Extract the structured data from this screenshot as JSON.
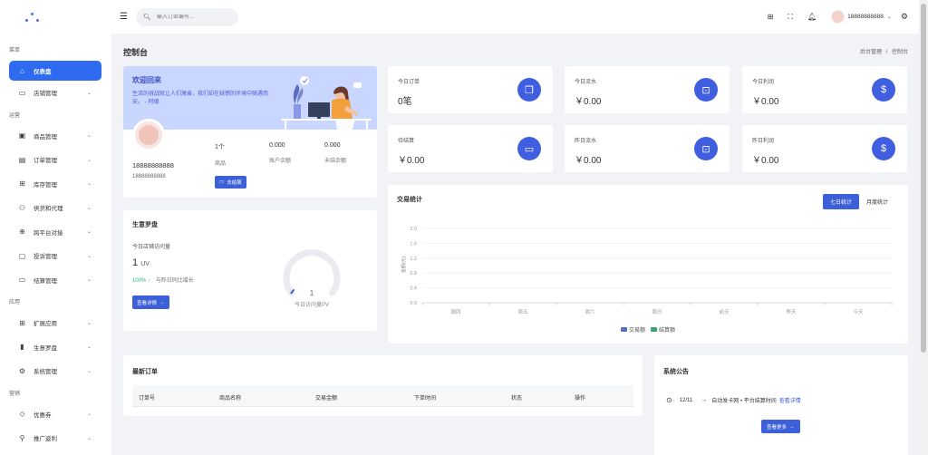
{
  "sidebar": {
    "sections": [
      {
        "label": "菜单",
        "items": [
          {
            "label": "仪表盘",
            "icon": "home-icon",
            "active": true
          },
          {
            "label": "店铺管理",
            "icon": "store-icon"
          }
        ]
      },
      {
        "label": "运营",
        "items": [
          {
            "label": "商品管理",
            "icon": "goods-icon"
          },
          {
            "label": "订单管理",
            "icon": "order-icon"
          },
          {
            "label": "库存管理",
            "icon": "inventory-icon"
          },
          {
            "label": "供货和代理",
            "icon": "supply-icon"
          },
          {
            "label": "跨平台对接",
            "icon": "globe-icon"
          },
          {
            "label": "投诉管理",
            "icon": "complaint-icon"
          },
          {
            "label": "结算管理",
            "icon": "settlement-icon"
          }
        ]
      },
      {
        "label": "应用",
        "items": [
          {
            "label": "扩展应用",
            "icon": "apps-icon"
          },
          {
            "label": "生意罗盘",
            "icon": "bar-chart-icon"
          },
          {
            "label": "系统管理",
            "icon": "gear-icon"
          }
        ]
      },
      {
        "label": "营销",
        "items": [
          {
            "label": "优惠券",
            "icon": "coupon-icon"
          },
          {
            "label": "推广返利",
            "icon": "promo-icon"
          }
        ]
      }
    ]
  },
  "topbar": {
    "search_placeholder": "输入订单编号...",
    "username": "18888888888"
  },
  "page": {
    "title": "控制台",
    "breadcrumb": [
      "后台管理",
      "/",
      "控制台"
    ]
  },
  "welcome": {
    "title": "欢迎回来",
    "subtitle": "生活的挑战就让人们激奋，我们却在缺憾的环境中随遇而安。 - 阿德",
    "phone": "18888888888",
    "account": "18888888888",
    "stats": [
      {
        "value": "1个",
        "label": "商品"
      },
      {
        "value": "0.000",
        "label": "账户余额"
      },
      {
        "value": "0.000",
        "label": "未结余额"
      }
    ],
    "settle_button": "去结算"
  },
  "stat_cards": [
    {
      "title": "今日订单",
      "value": "0笔",
      "icon": "copy-icon"
    },
    {
      "title": "今日流水",
      "value": "￥0.00",
      "icon": "money-box-icon"
    },
    {
      "title": "今日利润",
      "value": "￥0.00",
      "icon": "coin-icon"
    },
    {
      "title": "待结算",
      "value": "￥0.00",
      "icon": "card-icon"
    },
    {
      "title": "昨日流水",
      "value": "￥0.00",
      "icon": "money-box-icon"
    },
    {
      "title": "昨日利润",
      "value": "￥0.00",
      "icon": "coin-icon"
    }
  ],
  "compass": {
    "title": "生意罗盘",
    "visits_label": "今日店铺访问量",
    "visits_value": "1",
    "visits_unit": "UV",
    "growth_pct": "100%",
    "growth_label": "与昨日同比增长",
    "detail_button": "查看详情",
    "gauge_value": "1",
    "gauge_label": "今日访问量PV"
  },
  "trade": {
    "title": "交易统计",
    "tabs": [
      "七日统计",
      "月度统计"
    ],
    "colors": {
      "trade": "#5470c6",
      "settle": "#3ba272"
    }
  },
  "chart_data": {
    "type": "bar",
    "title": "交易统计",
    "categories": [
      "周四",
      "周五",
      "周六",
      "周日",
      "前天",
      "昨天",
      "今天"
    ],
    "series": [
      {
        "name": "交易额",
        "values": [
          0,
          0,
          0,
          0,
          0,
          0,
          0
        ]
      },
      {
        "name": "结算额",
        "values": [
          0,
          0,
          0,
          0,
          0,
          0,
          0
        ]
      }
    ],
    "ylabel": "金额(元)",
    "yticks": [
      "0.0",
      "0.4",
      "0.8",
      "1.2",
      "1.6",
      "2.0"
    ],
    "ylim": [
      0,
      2.0
    ],
    "grid": true,
    "legend": "bottom"
  },
  "orders": {
    "title": "最新订单",
    "columns": [
      "订单号",
      "商品名称",
      "交易金额",
      "下单时间",
      "状态",
      "操作"
    ]
  },
  "notice": {
    "title": "系统公告",
    "date": "12/11",
    "text": "自动发卡网 • 平台结算时间",
    "link": "查看详情",
    "more_button": "查看更多"
  }
}
